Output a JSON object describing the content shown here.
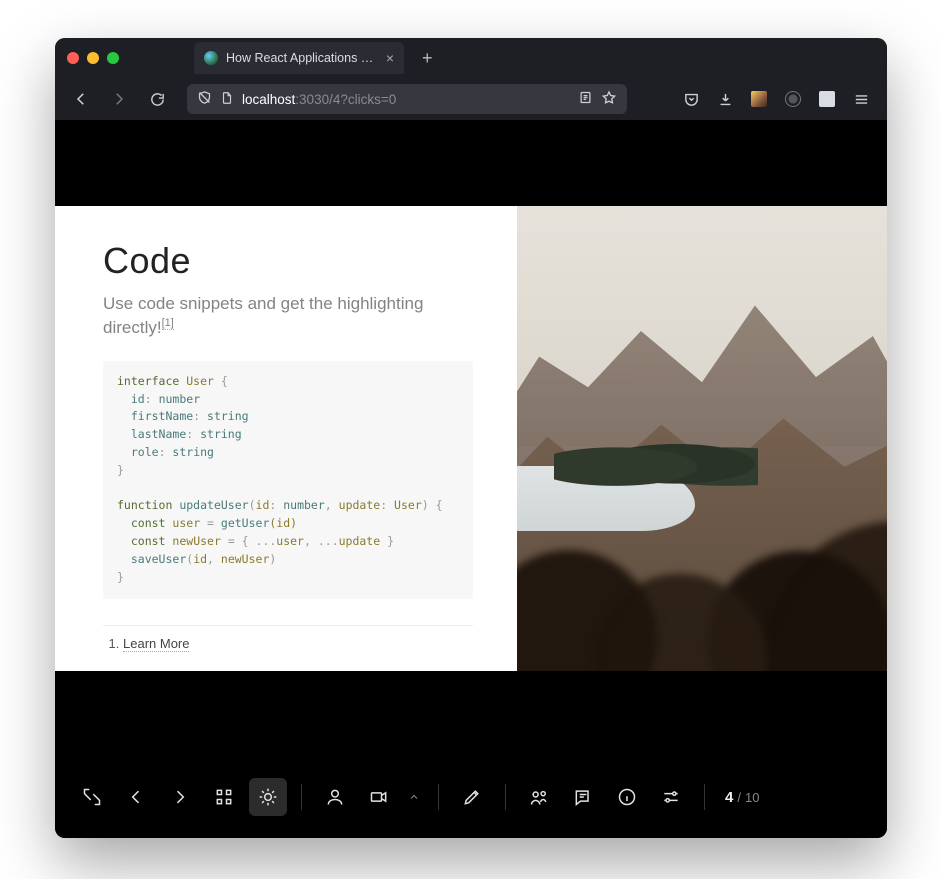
{
  "browser": {
    "tab_title": "How React Applications Get Hac",
    "url": {
      "host": "localhost",
      "port": ":3030",
      "path": "/4?clicks=0"
    },
    "newtab_glyph": "+",
    "tab_close_glyph": "×"
  },
  "slide": {
    "title": "Code",
    "subtitle_a": "Use code snippets and get the highlighting directly!",
    "subtitle_ref": "[1]",
    "footnote_index": "1.",
    "footnote_text": "Learn More"
  },
  "code": {
    "kw_interface": "interface",
    "type_user": "User",
    "brace_open": " {",
    "prop_id": "id",
    "colon": ": ",
    "prim_number": "number",
    "prop_first": "firstName",
    "prim_string": "string",
    "prop_last": "lastName",
    "prop_role": "role",
    "brace_close": "}",
    "kw_function": "function",
    "fn_update": "updateUser",
    "paren_open": "(",
    "param_id": "id",
    "comma": ", ",
    "param_update": "update",
    "paren_close_brace": ") {",
    "kw_const": "const",
    "var_user": "user",
    "eq": " = ",
    "fn_getuser": "getUser",
    "args_id": "(id)",
    "var_newuser": "newUser",
    "spread": " = { ...",
    "spread_mid": ", ...",
    "spread_end": " }",
    "fn_save": "saveUser",
    "args_save_a": "(",
    "args_save_b": ")"
  },
  "pager": {
    "current": "4",
    "separator": "/",
    "total": "10"
  }
}
